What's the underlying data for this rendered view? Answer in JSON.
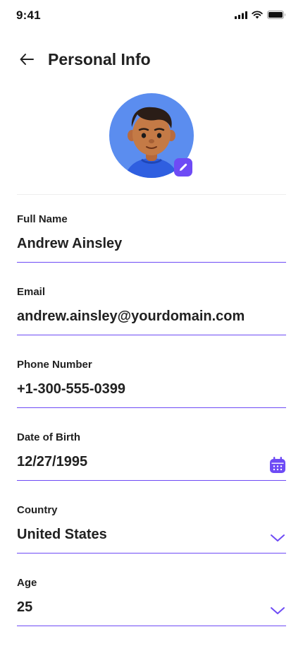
{
  "status_bar": {
    "time": "9:41"
  },
  "header": {
    "title": "Personal Info"
  },
  "profile": {
    "avatar_icon": "user-avatar",
    "edit_icon": "pencil-icon"
  },
  "fields": [
    {
      "label": "Full Name",
      "value": "Andrew Ainsley"
    },
    {
      "label": "Email",
      "value": "andrew.ainsley@yourdomain.com"
    },
    {
      "label": "Phone Number",
      "value": "+1-300-555-0399"
    },
    {
      "label": "Date of Birth",
      "value": "12/27/1995",
      "icon": "calendar-icon"
    },
    {
      "label": "Country",
      "value": "United States",
      "icon": "chevron-down-icon"
    },
    {
      "label": "Age",
      "value": "25",
      "icon": "chevron-down-icon"
    }
  ],
  "colors": {
    "accent": "#6e4bf5",
    "avatar_bg": "#5b8def",
    "text": "#212121"
  }
}
